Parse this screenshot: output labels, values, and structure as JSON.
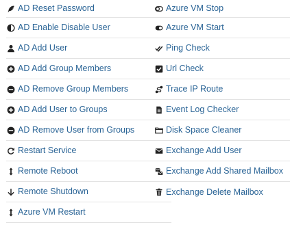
{
  "left_items": [
    {
      "label": "AD Reset Password",
      "icon": "feather-icon"
    },
    {
      "label": "AD Enable Disable User",
      "icon": "adjust-icon"
    },
    {
      "label": "AD Add User",
      "icon": "user-icon"
    },
    {
      "label": "AD Add Group Members",
      "icon": "plus-circle-icon"
    },
    {
      "label": "AD Remove Group Members",
      "icon": "minus-circle-icon"
    },
    {
      "label": "AD Add User to Groups",
      "icon": "plus-circle-icon"
    },
    {
      "label": "AD Remove User from Groups",
      "icon": "minus-circle-icon"
    },
    {
      "label": "Restart Service",
      "icon": "redo-icon"
    },
    {
      "label": "Remote Reboot",
      "icon": "vertical-arrows-icon"
    },
    {
      "label": "Remote Shutdown",
      "icon": "arrow-down-icon"
    },
    {
      "label": "Azure VM Restart",
      "icon": "vertical-arrows-icon"
    }
  ],
  "right_items": [
    {
      "label": "Azure VM Stop",
      "icon": "toggle-off-icon"
    },
    {
      "label": "Azure VM Start",
      "icon": "toggle-on-icon"
    },
    {
      "label": "Ping Check",
      "icon": "double-check-icon"
    },
    {
      "label": "Url Check",
      "icon": "checkbox-icon"
    },
    {
      "label": "Trace IP Route",
      "icon": "route-icon"
    },
    {
      "label": "Event Log Checker",
      "icon": "document-icon"
    },
    {
      "label": "Disk Space Cleaner",
      "icon": "folder-icon"
    },
    {
      "label": "Exchange Add User",
      "icon": "envelope-icon"
    },
    {
      "label": "Exchange Add Shared Mailbox",
      "icon": "shared-mailbox-icon"
    },
    {
      "label": "Exchange Delete Mailbox",
      "icon": "trash-icon"
    }
  ],
  "colors": {
    "link": "#2a6496",
    "icon": "#222222",
    "divider": "#e3e3e3"
  }
}
